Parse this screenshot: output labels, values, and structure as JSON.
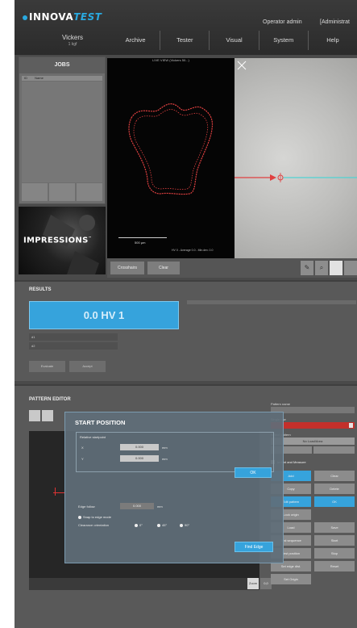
{
  "header": {
    "brand_left": "INNOVA",
    "brand_right": "TEST",
    "operator": "Operator admin",
    "admin": "[Administrat",
    "mode_title": "Vickers",
    "mode_sub": "1 kgf",
    "nav": [
      "Archive",
      "Tester",
      "Visual",
      "System",
      "Help"
    ]
  },
  "jobs": {
    "title": "JOBS",
    "column_id": "ID",
    "column_name": "Name"
  },
  "banner": {
    "text": "IMPRESSIONS",
    "mark": "™"
  },
  "camera": {
    "caption": "LIVE VIEW (Vickers 50...)",
    "scale_label": "500 µm",
    "footer": "HV 0 - Average 0.0 - Min.dev. 0.0",
    "buttons": [
      "Crosshairs",
      "Clear"
    ]
  },
  "results": {
    "title": "RESULTS",
    "value": "0.0 HV 1",
    "rows": [
      "d1",
      "d2"
    ],
    "buttons": [
      "Evaluate",
      "Accept"
    ]
  },
  "pattern_editor": {
    "title": "PATTERN EDITOR",
    "pattern_name_label": "Pattern name",
    "single_row_label": "Single row",
    "select_label": "Select pattern",
    "select_value": "No Load/Area",
    "check_label": "Indent and Measure",
    "grid": [
      "Add",
      "Clear",
      "Copy",
      "Delete",
      "Edit pattern",
      "OK",
      "Lock origin",
      "",
      "Load",
      "Save",
      "Test sequence",
      "Start",
      "Test position",
      "Stop",
      "Set edge dist.",
      "Reset",
      "Set Origin",
      ""
    ],
    "zoom": "Zoom",
    "pos": "0,0"
  },
  "dialog": {
    "title": "START POSITION",
    "group_label": "Relative startpoint",
    "x_label": "X",
    "y_label": "Y",
    "x_value": "0.000",
    "y_value": "0.000",
    "unit": "mm",
    "ok": "OK",
    "edge_label": "Edge follow",
    "edge_value": "0.000",
    "snap_label": "Snap to edge mode",
    "clearance_label": "Clearance orientation",
    "radio": [
      "0°",
      "45°",
      "90°"
    ],
    "find_edge": "Find Edge"
  },
  "colors": {
    "accent": "#36a3dc",
    "alert": "#c4302b",
    "outline": "#e04040"
  }
}
